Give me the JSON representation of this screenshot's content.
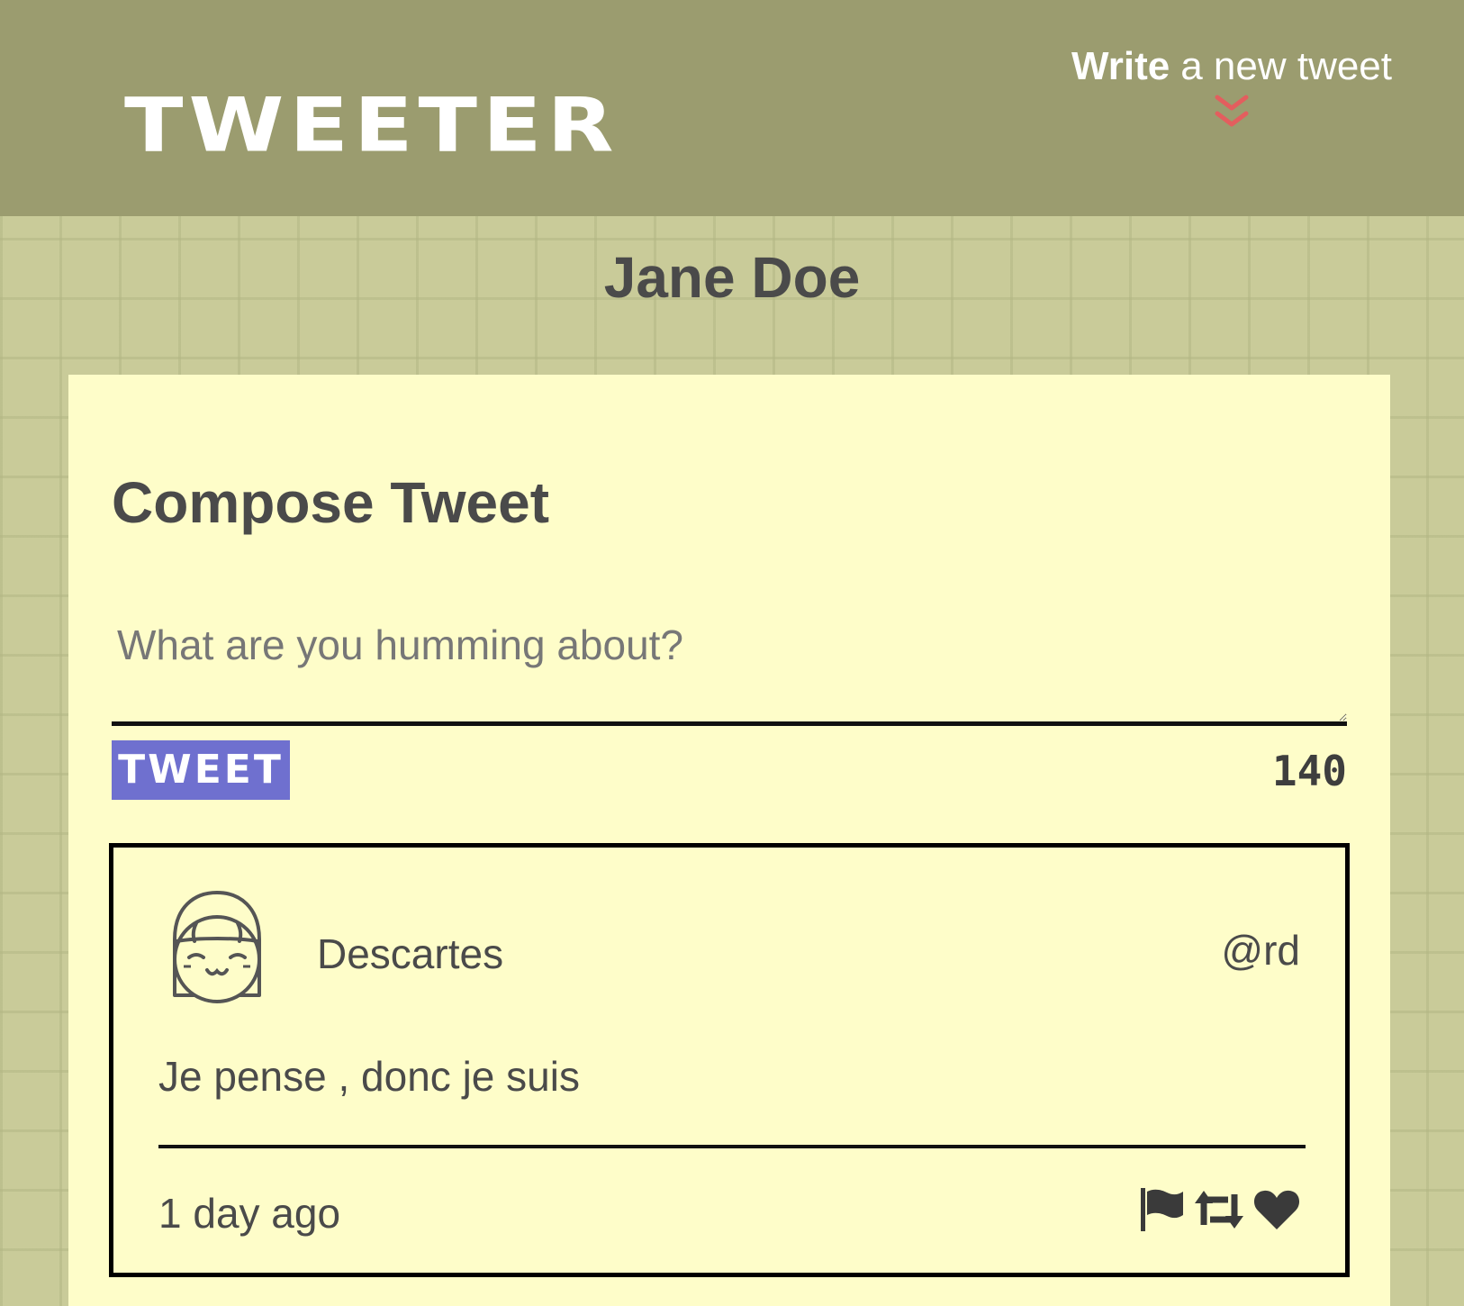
{
  "nav": {
    "brand": "TWEETER",
    "write_bold": "Write",
    "write_rest": "a new tweet",
    "chevron_color": "#e35e5e"
  },
  "profile": {
    "name": "Jane Doe"
  },
  "compose": {
    "title": "Compose Tweet",
    "placeholder": "What are you humming about?",
    "value": "",
    "button_label": "TWEET",
    "button_color": "#6f70cf",
    "char_counter": "140"
  },
  "tweets": [
    {
      "avatar_icon": "girl-avatar-icon",
      "name": "Descartes",
      "handle": "@rd",
      "text": "Je pense , donc je suis",
      "timestamp": "1 day ago",
      "actions": [
        "flag-icon",
        "retweet-icon",
        "heart-icon"
      ]
    }
  ],
  "colors": {
    "nav_background": "#9b9c6f",
    "page_background": "#c9cb99",
    "card_background": "#fefdc9",
    "text": "#4a4a4a"
  }
}
